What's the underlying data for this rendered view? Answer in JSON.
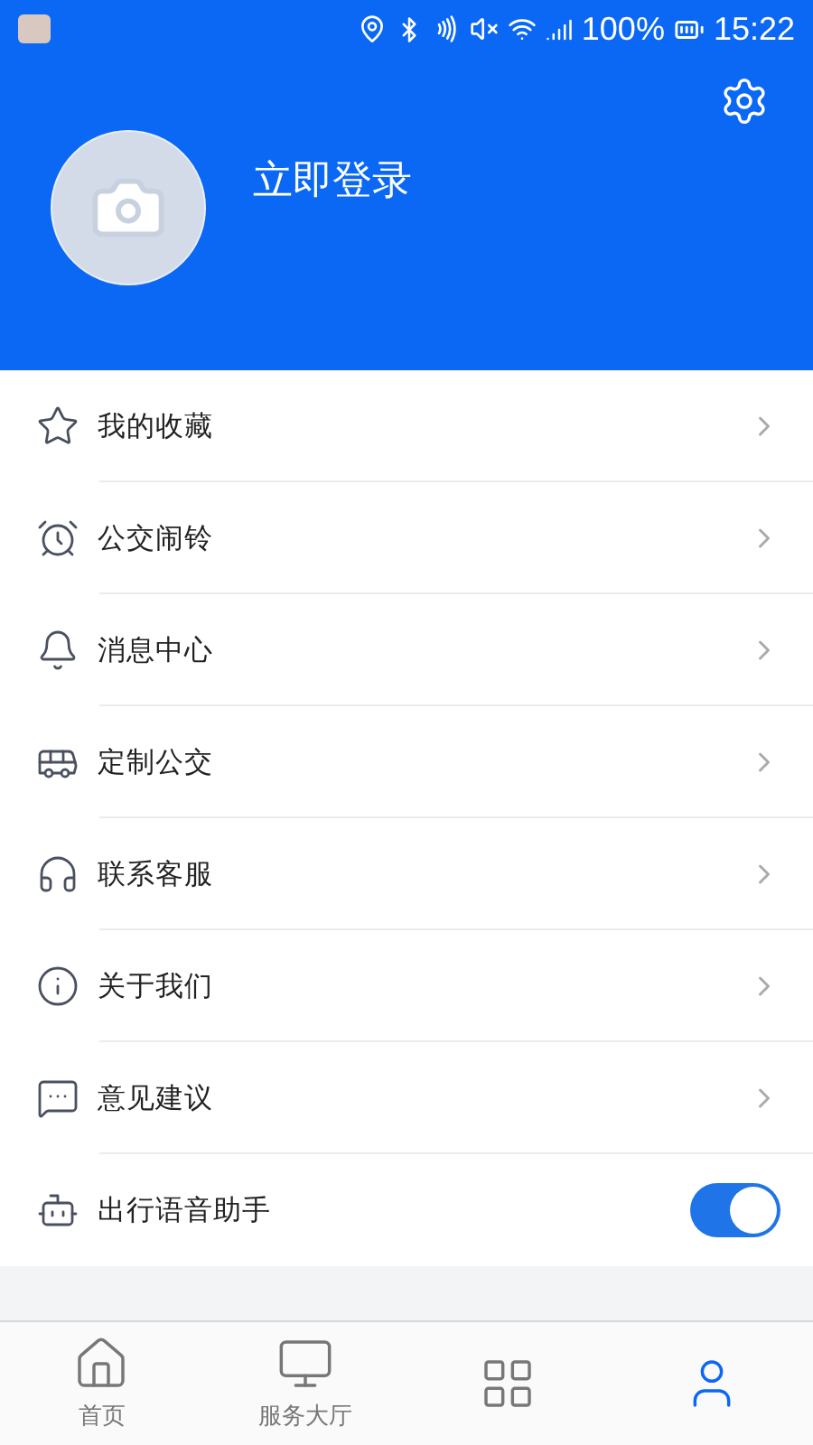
{
  "status_bar": {
    "battery": "100%",
    "time": "15:22"
  },
  "profile": {
    "login": "立即登录"
  },
  "menu": [
    {
      "kind": "link",
      "label": "我的收藏"
    },
    {
      "kind": "link",
      "label": "公交闹铃"
    },
    {
      "kind": "link",
      "label": "消息中心"
    },
    {
      "kind": "link",
      "label": "定制公交"
    },
    {
      "kind": "link",
      "label": "联系客服"
    },
    {
      "kind": "link",
      "label": "关于我们"
    },
    {
      "kind": "link",
      "label": "意见建议"
    },
    {
      "kind": "toggle",
      "label": "出行语音助手",
      "on": true
    }
  ],
  "tab_bar": [
    {
      "label": "首页",
      "selected": false
    },
    {
      "label": "服务大厅",
      "selected": false
    },
    {
      "selected": false
    },
    {
      "selected": true
    }
  ]
}
